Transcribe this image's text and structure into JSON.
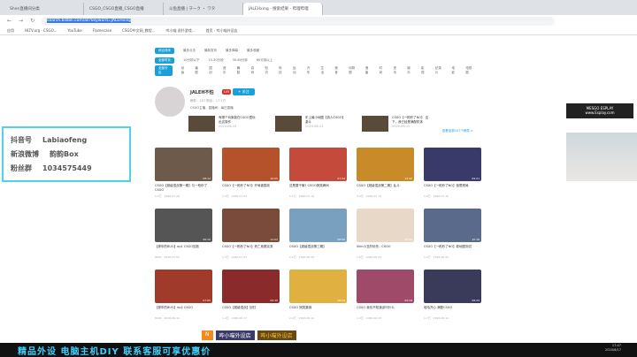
{
  "browser": {
    "tabs": [
      "Shen直播间分类",
      "CSGO_CSGO直播_CSGO直播",
      "斗鱼直播 | ヲーク ・ ワタ",
      "JALEHxing - 搜索结果 - 哔哩哔哩"
    ],
    "url_host": "search.bilibili.com/all?keyword=JALEHxing",
    "bookmarks": [
      "应用",
      "HLTV.org - CSGO...",
      "YouTube",
      "Flamecase",
      "CSGO中文网_教程...",
      "哔小喵 虎扑游戏...",
      "首页 - 哔小喵外设店"
    ]
  },
  "filters": {
    "rows": [
      [
        "综合排序",
        "最多点击",
        "最新发布",
        "最多弹幕",
        "最多收藏"
      ],
      [
        "全部时长",
        "10分钟以下",
        "10-30分钟",
        "30-60分钟",
        "60分钟以上"
      ],
      [
        "全部分区",
        "动画",
        "番剧",
        "国创",
        "音乐",
        "舞蹈",
        "游戏",
        "知识",
        "科技",
        "运动",
        "汽车",
        "生活",
        "美食",
        "动物圈",
        "鬼畜",
        "时尚",
        "资讯",
        "娱乐",
        "影视",
        "纪录片",
        "电影",
        "电视剧"
      ]
    ]
  },
  "user": {
    "name": "JALEH不怕",
    "level": "LV5",
    "follow": "+ 关注",
    "stats": "稿件：107  粉丝：17.1万",
    "desc": "CSGO主播，直播间：每日直播",
    "videos": [
      {
        "title": "有哪个玩家能在CSGO里玩出这操作",
        "date": "2020-06-15"
      },
      {
        "title": "史上最小地图【真人CSGO】激斗",
        "date": "2020-06-13"
      },
      {
        "title": "CSGO【一枪秒了NO】 这下，我已经是满配机体",
        "date": "2020-06-12"
      }
    ],
    "more": "查看全部107个稿件 >"
  },
  "grid": [
    {
      "title": "CSGO【超级混战第一期】与一枪秒了CSGO",
      "views": "1.5万",
      "date": "2020-07-28",
      "dur": "08:12",
      "c": "#6d5a4a"
    },
    {
      "title": "CSGO【一枪秒了NO】开局被围攻",
      "views": "2.3万",
      "date": "2020-07-22",
      "dur": "10:05",
      "c": "#b5512b"
    },
    {
      "title": "这是要干嘛? CSGO搞笑瞬间",
      "views": "1.1万",
      "date": "2020-07-18",
      "dur": "07:44",
      "c": "#c44a3c"
    },
    {
      "title": "CSGO【超级混战第二期】乱斗",
      "views": "3.2万",
      "date": "2020-07-15",
      "dur": "12:30",
      "c": "#c98a2a"
    },
    {
      "title": "CSGO【一枪秒了NO】极限残局",
      "views": "1.8万",
      "date": "2020-07-10",
      "dur": "09:21",
      "c": "#3a3a6a"
    },
    {
      "title": "【那年的BUG】ep1 CSGO回放",
      "views": "9821",
      "date": "2020-07-05",
      "dur": "06:10",
      "c": "#555"
    },
    {
      "title": "CSGO【一枪秒了NO】死亡竞赛实录",
      "views": "1.3万",
      "date": "2020-07-01",
      "dur": "11:02",
      "c": "#7a4a3a"
    },
    {
      "title": "CSGO【超级混战第三期】",
      "views": "2.1万",
      "date": "2020-06-28",
      "dur": "08:55",
      "c": "#7aa0c0"
    },
    {
      "title": "Skin小丑的忧伤 - CSGO",
      "views": "1.6万",
      "date": "2020-06-25",
      "dur": "05:40",
      "c": "#e8d8c8"
    },
    {
      "title": "CSGO【一枪秒了NO】新地图测试",
      "views": "1.2万",
      "date": "2020-06-22",
      "dur": "10:18",
      "c": "#5a6a8a"
    },
    {
      "title": "【那年的BUG】ep2 CSGO",
      "views": "8900",
      "date": "2020-06-19",
      "dur": "07:05",
      "c": "#a03a2a"
    },
    {
      "title": "CSGO【超级混战】回归",
      "views": "1.4万",
      "date": "2020-06-17",
      "dur": "09:30",
      "c": "#8a2a2a"
    },
    {
      "title": "CSGO 搞笑集锦",
      "views": "2.0万",
      "date": "2020-06-16",
      "dur": "08:29",
      "c": "#e0b040"
    },
    {
      "title": "CSGO 我也不知道该叫什么",
      "views": "1.0万",
      "date": "2020-06-15",
      "dur": "06:29",
      "c": "#a04a6a"
    },
    {
      "title": "哈哈开心 满配CSGO",
      "views": "1.7万",
      "date": "2020-06-14",
      "dur": "08:29",
      "c": "#3a3a5a"
    }
  ],
  "social": [
    [
      "抖音号",
      "Labiaofeng"
    ],
    [
      "新浪微博",
      "韵韵Box"
    ],
    [
      "粉丝群",
      "1034575449"
    ]
  ],
  "stream": {
    "brand": "MESGO ESPLAY",
    "brand_sub": "www.Esplay.com",
    "overlay": [
      "哔小喵外设店",
      "哔小喵外设店"
    ],
    "ad": "精品外设 电脑主机DIY 联系客服可享优惠价",
    "time": "17:47",
    "date": "2020/6/17"
  }
}
